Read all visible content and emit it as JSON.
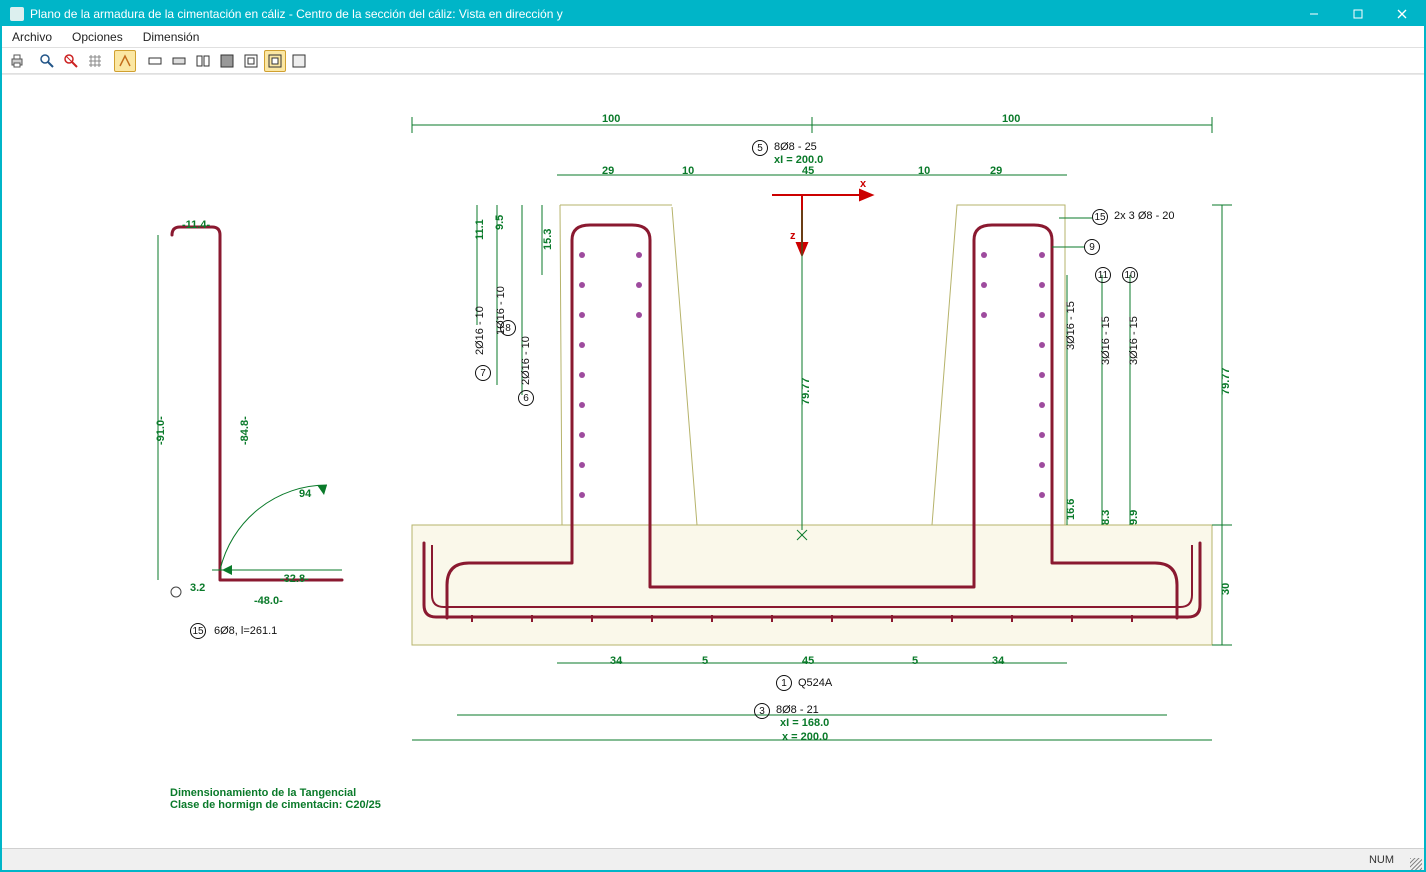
{
  "window": {
    "title": "Plano de la armadura de la cimentación en cáliz - Centro de la sección del cáliz: Vista en dirección y"
  },
  "menu": {
    "archivo": "Archivo",
    "opciones": "Opciones",
    "dimension": "Dimensión"
  },
  "toolbar": {
    "print": "print",
    "zoomin": "zoom-in",
    "zoomout": "zoom-extents",
    "grid": "toggle-grid",
    "grp": "toggle-group",
    "b1": "view1",
    "b2": "view2",
    "b3": "view3",
    "b4": "view4",
    "b5": "view5",
    "b6": "view6",
    "b7": "view7"
  },
  "status": {
    "num": "NUM"
  },
  "left": {
    "top": "-11.4-",
    "mid": "-84.8-",
    "h": "-91.0-",
    "angle": "94",
    "rad": "3.2",
    "bot1": "-32.8-",
    "bot2": "-48.0-",
    "bar15": "6Ø8, l=261.1"
  },
  "dims": {
    "t100a": "100",
    "t100b": "100",
    "t29a": "29",
    "t10a": "10",
    "t45": "45",
    "t10b": "10",
    "t29b": "29",
    "b34a": "34",
    "b5a": "5",
    "b45": "45",
    "b5b": "5",
    "b34b": "34",
    "h11": "11.1",
    "h95": "9.5",
    "h153": "15.3",
    "r166": "16.6",
    "r83": "8.3",
    "r99": "9.9",
    "r30": "30",
    "r7977": "79.77",
    "c7977": "79.77",
    "x200": "x = 200.0",
    "xi168": "xI = 168.0",
    "xi200": "xI = 200.0"
  },
  "bars": {
    "b5": "8Ø8 - 25",
    "b7": "2Ø16 - 10",
    "b8": "1Ø16 - 10",
    "b6": "2Ø16 - 10",
    "b10": "3Ø16 - 15",
    "b11": "3Ø16 - 15",
    "b12": "3Ø16 - 15",
    "b15": "2x 3 Ø8 - 20",
    "b3": "8Ø8 - 21",
    "b1": "Q524A"
  },
  "axes": {
    "x": "x",
    "z": "z"
  },
  "footer": {
    "l1": "Dimensionamiento de la Tangencial",
    "l2": "Clase de hormign de cimentacin: C20/25"
  }
}
